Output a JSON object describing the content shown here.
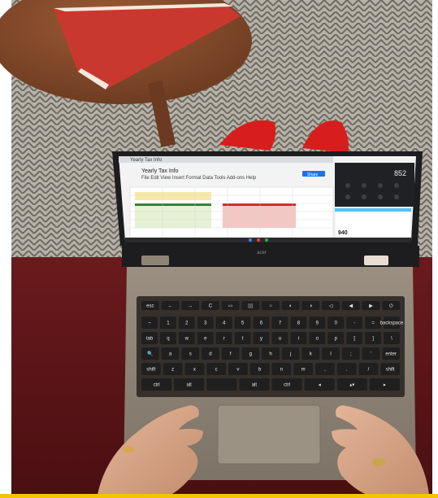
{
  "photo": {
    "subject": "laptop-on-lap",
    "screen": {
      "window_title": "Yearly Tax Info",
      "doc_title": "Yearly Tax Info",
      "menu": [
        "File",
        "Edit",
        "View",
        "Insert",
        "Format",
        "Data",
        "Tools",
        "Add-ons",
        "Help"
      ],
      "share_label": "Share",
      "calculator_display": "852",
      "receipt_value": "940"
    },
    "keyboard": {
      "row1": [
        "esc",
        "←",
        "→",
        "C",
        "▭",
        "▯▯",
        "○",
        "◐",
        "◑",
        "◁",
        "◀",
        "▶",
        "⏻"
      ],
      "row2": [
        "~",
        "1",
        "2",
        "3",
        "4",
        "5",
        "6",
        "7",
        "8",
        "9",
        "0",
        "-",
        "=",
        "backspace"
      ],
      "row3": [
        "tab",
        "q",
        "w",
        "e",
        "r",
        "t",
        "y",
        "u",
        "i",
        "o",
        "p",
        "[",
        "]",
        "\\"
      ],
      "row4": [
        "🔍",
        "a",
        "s",
        "d",
        "f",
        "g",
        "h",
        "j",
        "k",
        "l",
        ";",
        "'",
        "enter"
      ],
      "row5": [
        "shift",
        "z",
        "x",
        "c",
        "v",
        "b",
        "n",
        "m",
        ",",
        ".",
        "/",
        "shift"
      ],
      "row6": [
        "ctrl",
        "alt",
        "",
        "alt",
        "ctrl",
        "◂",
        "▴▾",
        "▸"
      ]
    },
    "brand": "acer",
    "colors": {
      "floor": "#b8b4ab",
      "table": "#8a4d2c",
      "book": "#d8493f",
      "sofa": "#5e1518",
      "laptop_body": "#8e8476",
      "keyboard": "#2b2b2b",
      "shoes": "#d81d1d",
      "skin": "#d9a98a"
    }
  }
}
